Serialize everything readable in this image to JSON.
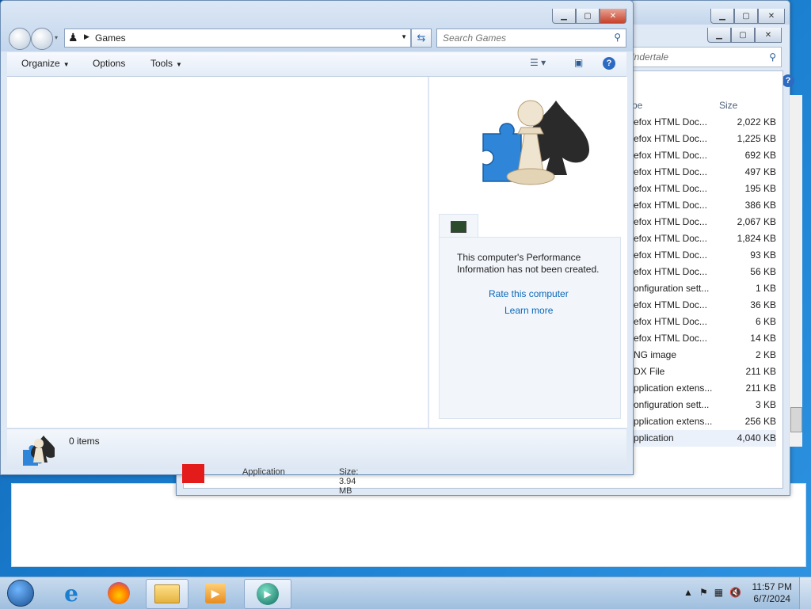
{
  "background_window": {
    "search_placeholder": "rch Undertale",
    "columns": {
      "type": "pe",
      "size": "Size"
    },
    "rows": [
      {
        "type": "efox HTML Doc...",
        "size": "2,022 KB"
      },
      {
        "type": "efox HTML Doc...",
        "size": "1,225 KB"
      },
      {
        "type": "efox HTML Doc...",
        "size": "692 KB"
      },
      {
        "type": "efox HTML Doc...",
        "size": "497 KB"
      },
      {
        "type": "efox HTML Doc...",
        "size": "195 KB"
      },
      {
        "type": "efox HTML Doc...",
        "size": "386 KB"
      },
      {
        "type": "efox HTML Doc...",
        "size": "2,067 KB"
      },
      {
        "type": "efox HTML Doc...",
        "size": "1,824 KB"
      },
      {
        "type": "efox HTML Doc...",
        "size": "93 KB"
      },
      {
        "type": "efox HTML Doc...",
        "size": "56 KB"
      },
      {
        "type": "onfiguration sett...",
        "size": "1 KB"
      },
      {
        "type": "efox HTML Doc...",
        "size": "36 KB"
      },
      {
        "type": "efox HTML Doc...",
        "size": "6 KB"
      },
      {
        "type": "efox HTML Doc...",
        "size": "14 KB"
      },
      {
        "type": "NG image",
        "size": "2 KB"
      },
      {
        "type": "DX File",
        "size": "211 KB"
      },
      {
        "type": "pplication extens...",
        "size": "211 KB"
      },
      {
        "type": "onfiguration sett...",
        "size": "3 KB"
      },
      {
        "type": "pplication extens...",
        "size": "256 KB"
      },
      {
        "type": "pplication",
        "size": "4,040 KB"
      }
    ],
    "below_left": "Application",
    "below_right": "Size: 3.94 MB"
  },
  "games_window": {
    "address": "Games",
    "search_placeholder": "Search Games",
    "toolbar": {
      "organize": "Organize",
      "options": "Options",
      "tools": "Tools"
    },
    "perf_message": "This computer's Performance Information has not been created.",
    "links": {
      "rate": "Rate this computer",
      "learn": "Learn more"
    },
    "status": "0 items"
  },
  "taskbar": {
    "time": "11:57 PM",
    "date": "6/7/2024"
  },
  "colors": {
    "link": "#0a66b7",
    "close": "#c7412a"
  }
}
